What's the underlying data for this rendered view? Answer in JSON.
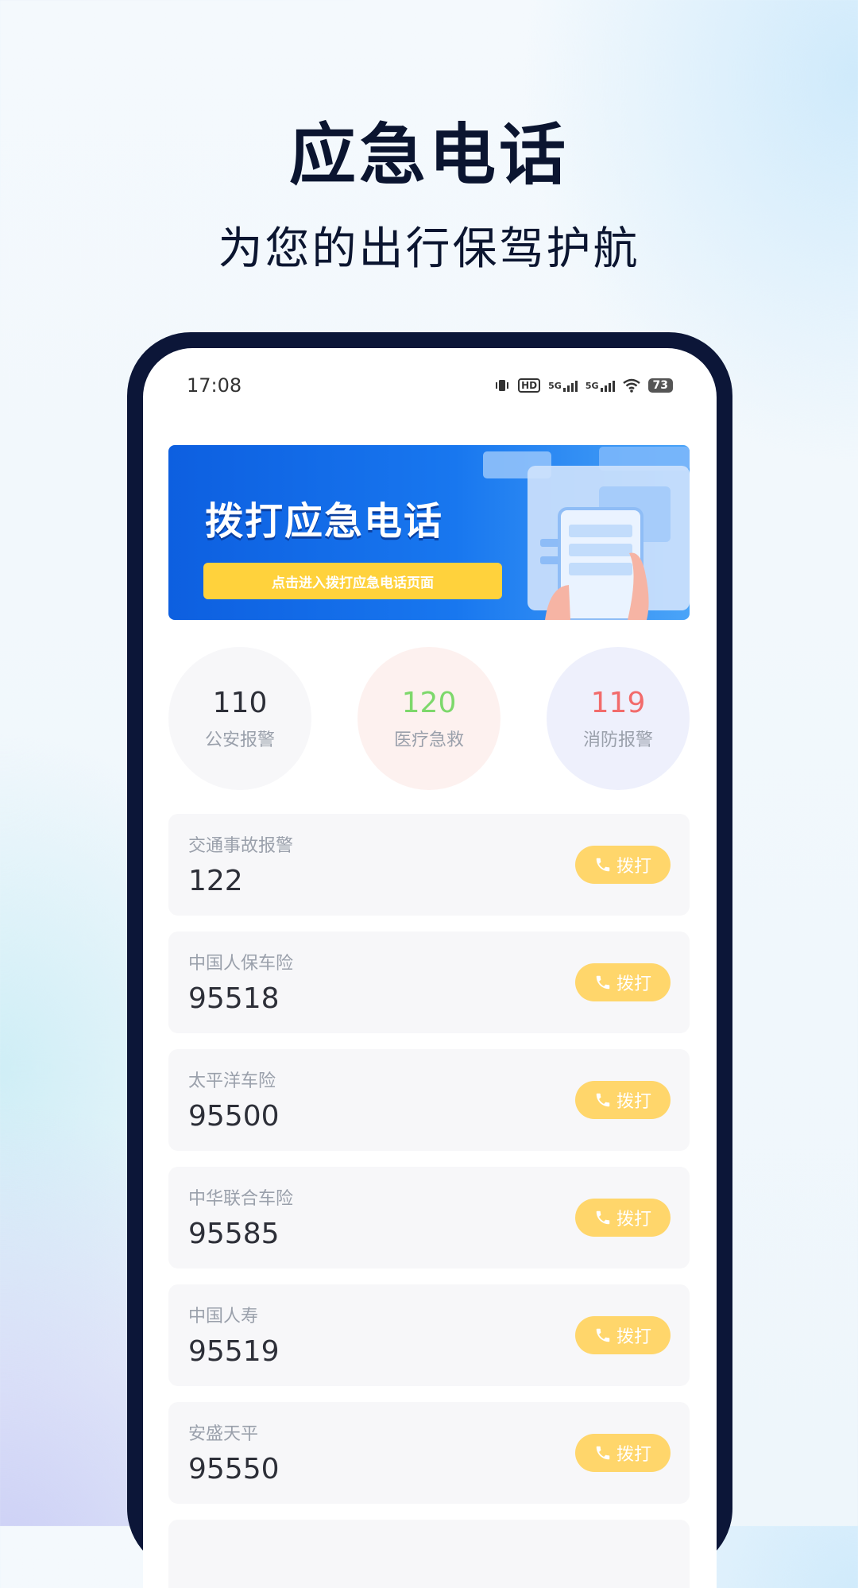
{
  "promo": {
    "title": "应急电话",
    "subtitle": "为您的出行保驾护航"
  },
  "status_bar": {
    "time": "17:08",
    "network_1": "5G",
    "network_2": "5G",
    "hd_label": "HD",
    "battery": "73"
  },
  "banner": {
    "title": "拨打应急电话",
    "button_label": "点击进入拨打应急电话页面"
  },
  "quick_dial": [
    {
      "number": "110",
      "label": "公安报警",
      "color": "#2d2f38",
      "bg": "#f7f7f9"
    },
    {
      "number": "120",
      "label": "医疗急救",
      "color": "#7dd86b",
      "bg": "#fdf1ef"
    },
    {
      "number": "119",
      "label": "消防报警",
      "color": "#f26b6b",
      "bg": "#eef0fc"
    }
  ],
  "contacts": [
    {
      "name": "交通事故报警",
      "number": "122",
      "action": "拨打"
    },
    {
      "name": "中国人保车险",
      "number": "95518",
      "action": "拨打"
    },
    {
      "name": "太平洋车险",
      "number": "95500",
      "action": "拨打"
    },
    {
      "name": "中华联合车险",
      "number": "95585",
      "action": "拨打"
    },
    {
      "name": "中国人寿",
      "number": "95519",
      "action": "拨打"
    },
    {
      "name": "安盛天平",
      "number": "95550",
      "action": "拨打"
    }
  ],
  "colors": {
    "accent_yellow": "#ffd66b",
    "banner_blue": "#0d5fe0",
    "phone_frame": "#0c1638"
  }
}
